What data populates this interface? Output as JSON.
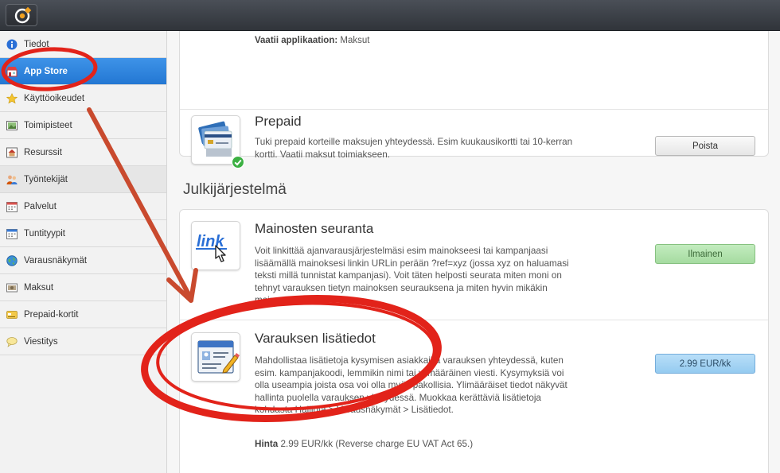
{
  "sidebar": {
    "items": [
      {
        "label": "Tiedot",
        "icon": "info-icon"
      },
      {
        "label": "App Store",
        "icon": "store-icon"
      },
      {
        "label": "Käyttöoikeudet",
        "icon": "star-icon"
      },
      {
        "label": "Toimipisteet",
        "icon": "image-icon"
      },
      {
        "label": "Resurssit",
        "icon": "house-icon"
      },
      {
        "label": "Työntekijät",
        "icon": "people-icon"
      },
      {
        "label": "Palvelut",
        "icon": "calendar-icon"
      },
      {
        "label": "Tuntityypit",
        "icon": "calendar-icon"
      },
      {
        "label": "Varausnäkymät",
        "icon": "globe-icon"
      },
      {
        "label": "Maksut",
        "icon": "cash-icon"
      },
      {
        "label": "Prepaid-kortit",
        "icon": "card-icon"
      },
      {
        "label": "Viestitys",
        "icon": "chat-icon"
      }
    ]
  },
  "top_card": {
    "requires_label": "Vaatii applikaation:",
    "requires_value": "Maksut"
  },
  "prepaid": {
    "title": "Prepaid",
    "desc": "Tuki prepaid korteille maksujen yhteydessä. Esim kuukausikortti tai 10-kerran kortti. Vaatii maksut toimiakseen.",
    "button": "Poista",
    "icon": "prepaid-cards-icon"
  },
  "section": {
    "heading": "Julkijärjestelmä"
  },
  "apps": [
    {
      "title": "Mainosten seuranta",
      "desc": "Voit linkittää ajanvarausjärjestelmäsi esim mainokseesi tai kampanjaasi lisäämällä mainoksesi linkin URLin perään ?ref=xyz (jossa xyz on haluamasi teksti millä tunnistat kampanjasi). Voit täten helposti seurata miten moni on tehnyt varauksen tietyn mainoksen seurauksena ja miten hyvin mikäkin mainos toimii.",
      "button": "Ilmainen",
      "icon": "link-icon",
      "icon_text": "link"
    },
    {
      "title": "Varauksen lisätiedot",
      "desc": "Mahdollistaa lisätietoja kysymisen asiakkailta varauksen yhteydessä, kuten esim. kampanjakoodi, lemmikin nimi tai ylimääräinen viesti. Kysymyksiä voi olla useampia joista osa voi olla myös pakollisia. Ylimääräiset tiedot näkyvät hallinta puolella varauksen yhteydessä. Muokkaa kerättäviä lisätietoja kohdasta Hallinta > Varausnäkymät > Lisätiedot.",
      "price_label": "Hinta",
      "price_value": "2.99 EUR/kk (Reverse charge EU VAT Act 65.)",
      "button": "2.99 EUR/kk",
      "icon": "form-edit-icon"
    }
  ],
  "annotations": {
    "color": "#e2231a",
    "arrow_color": "#c94a2e"
  }
}
